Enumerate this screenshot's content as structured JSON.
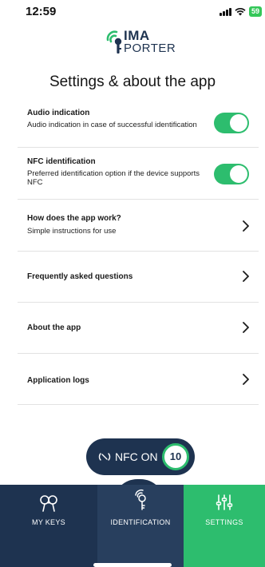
{
  "status_bar": {
    "time": "12:59",
    "battery": "59"
  },
  "logo": {
    "line1": "IMA",
    "line2": "PORTER"
  },
  "page_title": "Settings & about the app",
  "settings": [
    {
      "title": "Audio indication",
      "subtitle": "Audio indication in case of successful identification",
      "toggle_on": true
    },
    {
      "title": "NFC identification",
      "subtitle": "Preferred identification option if the device supports NFC",
      "toggle_on": true
    }
  ],
  "menu": [
    {
      "title": "How does the app work?",
      "subtitle": "Simple instructions for use"
    },
    {
      "title": "Frequently asked questions"
    },
    {
      "title": "About the app"
    },
    {
      "title": "Application logs"
    }
  ],
  "nfc": {
    "label": "NFC ON",
    "count": "10"
  },
  "nav": [
    {
      "label": "MY KEYS",
      "icon": "keys-icon"
    },
    {
      "label": "IDENTIFICATION",
      "icon": "key-tag-icon"
    },
    {
      "label": "SETTINGS",
      "icon": "sliders-icon",
      "active": true
    }
  ],
  "colors": {
    "brand_navy": "#1e3350",
    "accent_green": "#2dbd6e"
  }
}
